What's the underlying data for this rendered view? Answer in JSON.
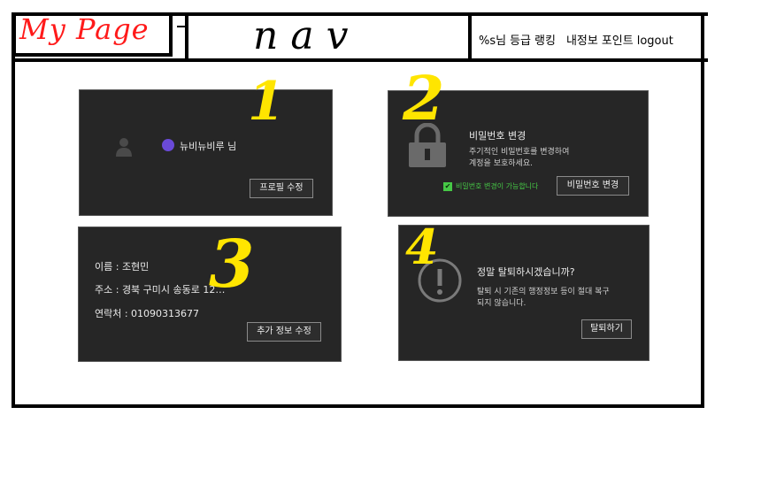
{
  "header": {
    "logo": "My Page",
    "nav": "nav",
    "menu": [
      "%s님",
      "등급",
      "랭킹",
      "내정보",
      "포인트",
      "logout"
    ]
  },
  "profile": {
    "nickname": "뉴비뉴비루 님",
    "button": "프로필 수정",
    "marker": "1"
  },
  "password": {
    "title": "비밀번호 변경",
    "desc1": "주기적인 비밀번호를 변경하여",
    "desc2": "계정을 보호하세요.",
    "status": "비밀번호 변경이 가능합니다",
    "button": "비밀번호 변경",
    "marker": "2"
  },
  "info": {
    "name": "이름 : 조현민",
    "address": "주소 : 경북 구미시 송동로 12…",
    "phone": "연락처 : 01090313677",
    "button": "추가 정보 수정",
    "marker": "3"
  },
  "withdraw": {
    "title": "정말 탈퇴하시겠습니까?",
    "desc1": "탈퇴 시 기존의 행정정보 등이 절대 복구",
    "desc2": "되지 않습니다.",
    "button": "탈퇴하기",
    "marker": "4"
  },
  "colors": {
    "panel": "#262626",
    "logo": "#ff1a1a",
    "marker": "#ffe500",
    "status": "#46c846",
    "avatar": "#6a4ad8"
  }
}
